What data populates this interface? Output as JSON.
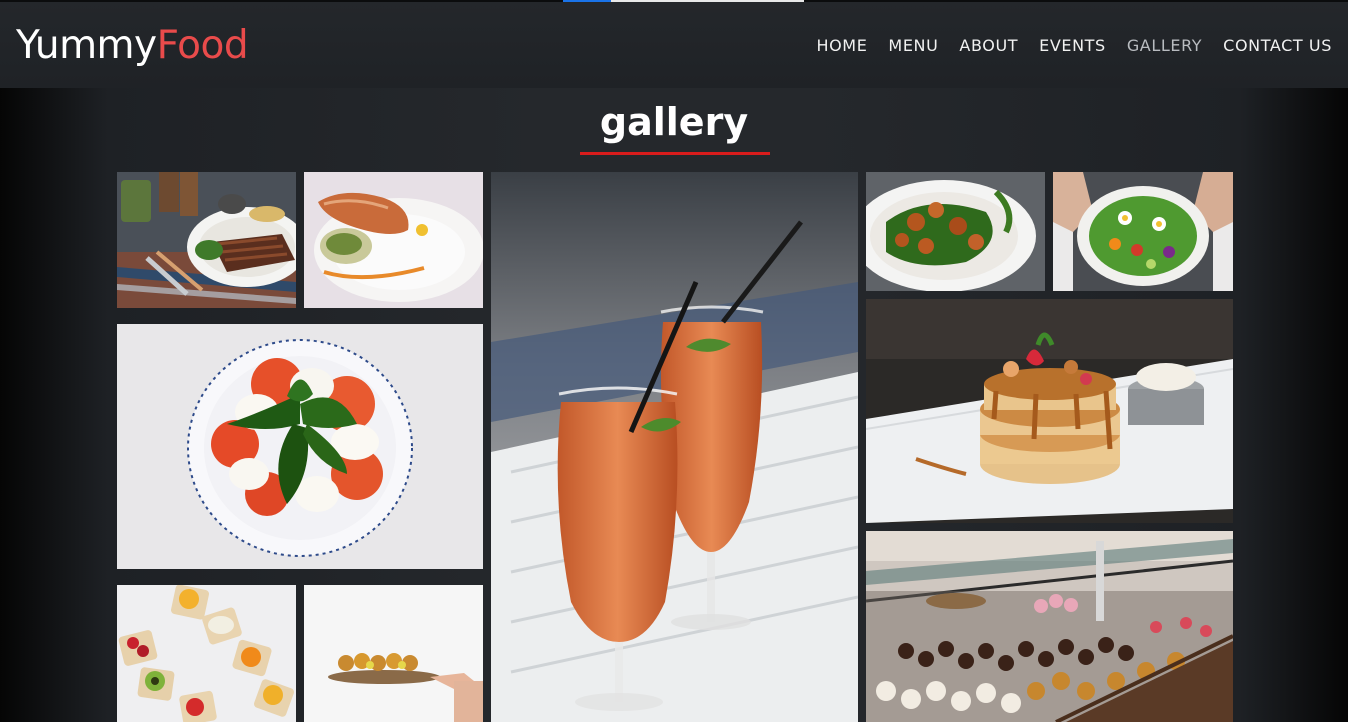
{
  "scroll_progress": 0.2,
  "brand": {
    "part1": "Yummy",
    "part2": "Food"
  },
  "nav": {
    "items": [
      {
        "label": "HOME"
      },
      {
        "label": "MENU"
      },
      {
        "label": "ABOUT"
      },
      {
        "label": "EVENTS"
      },
      {
        "label": "GALLERY"
      },
      {
        "label": "CONTACT US"
      }
    ],
    "active": "GALLERY"
  },
  "gallery": {
    "title": "gallery",
    "images": [
      "steak",
      "salmon",
      "caprese",
      "toasts",
      "appetizers",
      "smoothies",
      "chicken-salad",
      "green-salad",
      "pancakes",
      "pastry-display"
    ]
  },
  "colors": {
    "accent": "#e94b4b",
    "underline": "#d91c1c"
  }
}
